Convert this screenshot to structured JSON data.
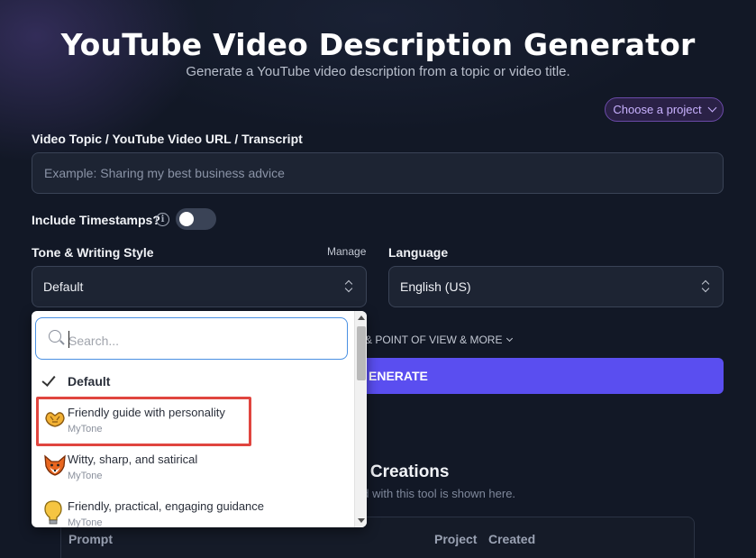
{
  "header": {
    "title": "YouTube Video Description Generator",
    "subtitle": "Generate a YouTube video description from a topic or video title."
  },
  "project_selector": {
    "label": "Choose a project"
  },
  "topic": {
    "label": "Video Topic / YouTube Video URL / Transcript",
    "placeholder": "Example: Sharing my best business advice",
    "value": ""
  },
  "timestamps": {
    "label": "Include Timestamps?",
    "enabled": false
  },
  "tone": {
    "label": "Tone & Writing Style",
    "manage_label": "Manage",
    "selected": "Default"
  },
  "language": {
    "label": "Language",
    "selected": "English (US)"
  },
  "more_options": {
    "label": "& POINT OF VIEW & MORE"
  },
  "generate": {
    "label": "ENERATE"
  },
  "creations": {
    "title": "s Creations",
    "subtitle": "ed with this tool is shown here.",
    "columns": [
      "Prompt",
      "Project",
      "Created"
    ]
  },
  "tone_dropdown": {
    "search_placeholder": "Search...",
    "items": [
      {
        "name": "Default",
        "selected": true
      },
      {
        "name": "Friendly guide with personality",
        "source": "MyTone",
        "icon": "hands-icon",
        "highlighted": true
      },
      {
        "name": "Witty, sharp, and satirical",
        "source": "MyTone",
        "icon": "fox-icon"
      },
      {
        "name": "Friendly, practical, engaging guidance",
        "source": "MyTone",
        "icon": "lightbulb-icon"
      }
    ]
  },
  "colors": {
    "accent": "#5a4ef0",
    "project_accent": "#c9b2ff",
    "highlight_box": "#e0453f",
    "focus_border": "#4a90e2"
  }
}
